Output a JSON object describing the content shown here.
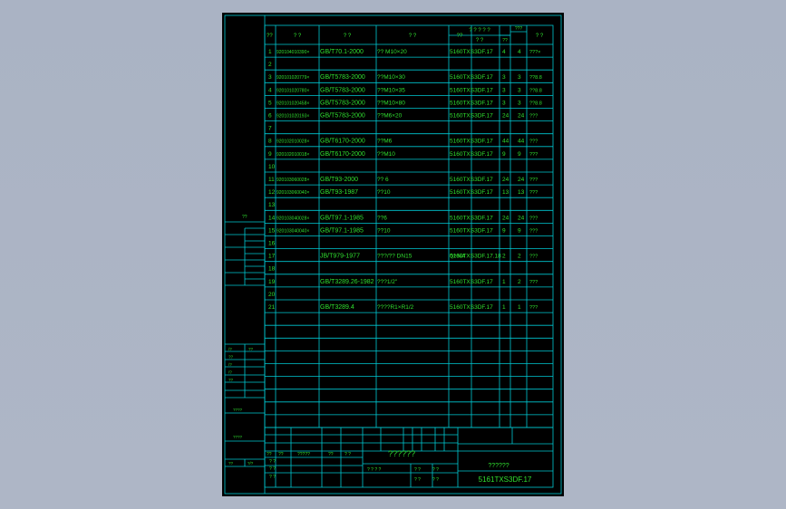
{
  "colors": {
    "background": "#aab3c4",
    "sheet": "#000000",
    "frame": "#00c8d2",
    "text": "#30e030"
  },
  "header": {
    "c1": "??",
    "c2": "?  ?",
    "c3": "?   ?",
    "c4": "?   ?",
    "c5": "??",
    "c6a": "? ? ? ? ?",
    "c6b": "?   ?",
    "c7a": "???",
    "c7b": "??",
    "c8": "?  ?"
  },
  "rows": [
    {
      "no": "1",
      "code": "920104010390×",
      "std": "GB/T70.1-2000",
      "name": "?? M10×20",
      "mat": "",
      "asm": "5160TXS3DF.17",
      "q1": "4",
      "q2": "4",
      "note": "???×"
    },
    {
      "no": "2",
      "code": "",
      "std": "",
      "name": "",
      "mat": "",
      "asm": "",
      "q1": "",
      "q2": "",
      "note": ""
    },
    {
      "no": "3",
      "code": "920101020779×",
      "std": "GB/T5783-2000",
      "name": "??M10×30",
      "mat": "",
      "asm": "5160TXS3DF.17",
      "q1": "3",
      "q2": "3",
      "note": "??8.8"
    },
    {
      "no": "4",
      "code": "920101020780×",
      "std": "GB/T5783-2000",
      "name": "??M10×35",
      "mat": "",
      "asm": "5160TXS3DF.17",
      "q1": "3",
      "q2": "3",
      "note": "??8.8"
    },
    {
      "no": "5",
      "code": "920101020458×",
      "std": "GB/T5783-2000",
      "name": "??M10×80",
      "mat": "",
      "asm": "5160TXS3DF.17",
      "q1": "3",
      "q2": "3",
      "note": "??8.8"
    },
    {
      "no": "6",
      "code": "920101020193×",
      "std": "GB/T5783-2000",
      "name": "??M6×20",
      "mat": "",
      "asm": "5160TXS3DF.17",
      "q1": "24",
      "q2": "24",
      "note": "???"
    },
    {
      "no": "7",
      "code": "",
      "std": "",
      "name": "",
      "mat": "",
      "asm": "",
      "q1": "",
      "q2": "",
      "note": ""
    },
    {
      "no": "8",
      "code": "920102010028×",
      "std": "GB/T6170-2000",
      "name": "??M6",
      "mat": "",
      "asm": "5160TXS3DF.17",
      "q1": "44",
      "q2": "44",
      "note": "???"
    },
    {
      "no": "9",
      "code": "920102010018×",
      "std": "GB/T6170-2000",
      "name": "??M10",
      "mat": "",
      "asm": "5160TXS3DF.17",
      "q1": "9",
      "q2": "9",
      "note": "???"
    },
    {
      "no": "10",
      "code": "",
      "std": "",
      "name": "",
      "mat": "",
      "asm": "",
      "q1": "",
      "q2": "",
      "note": ""
    },
    {
      "no": "11",
      "code": "920103060028×",
      "std": "GB/T93-2000",
      "name": "?? 6",
      "mat": "",
      "asm": "5160TXS3DF.17",
      "q1": "24",
      "q2": "24",
      "note": "???"
    },
    {
      "no": "12",
      "code": "920103060040×",
      "std": "GB/T93-1987",
      "name": "??10",
      "mat": "",
      "asm": "5160TXS3DF.17",
      "q1": "13",
      "q2": "13",
      "note": "???"
    },
    {
      "no": "13",
      "code": "",
      "std": "",
      "name": "",
      "mat": "",
      "asm": "",
      "q1": "",
      "q2": "",
      "note": ""
    },
    {
      "no": "14",
      "code": "920103040028×",
      "std": "GB/T97.1-1985",
      "name": "??6",
      "mat": "",
      "asm": "5160TXS3DF.17",
      "q1": "24",
      "q2": "24",
      "note": "???"
    },
    {
      "no": "15",
      "code": "920103040040×",
      "std": "GB/T97.1-1985",
      "name": "??10",
      "mat": "",
      "asm": "5160TXS3DF.17",
      "q1": "9",
      "q2": "9",
      "note": "???"
    },
    {
      "no": "16",
      "code": "",
      "std": "",
      "name": "",
      "mat": "",
      "asm": "",
      "q1": "",
      "q2": "",
      "note": ""
    },
    {
      "no": "17",
      "code": "",
      "std": "JB/T979-1977",
      "name": "???/?? DN15",
      "mat": "Q235A",
      "asm": "5160TXS3DF.17.18",
      "q1": "2",
      "q2": "2",
      "note": "???"
    },
    {
      "no": "18",
      "code": "",
      "std": "",
      "name": "",
      "mat": "",
      "asm": "",
      "q1": "",
      "q2": "",
      "note": ""
    },
    {
      "no": "19",
      "code": "",
      "std": "GB/T3289.26-1982",
      "name": "???1/2\"",
      "mat": "",
      "asm": "5160TXS3DF.17",
      "q1": "1",
      "q2": "2",
      "note": "???"
    },
    {
      "no": "20",
      "code": "",
      "std": "",
      "name": "",
      "mat": "",
      "asm": "",
      "q1": "",
      "q2": "",
      "note": ""
    },
    {
      "no": "21",
      "code": "",
      "std": "GB/T3289.4",
      "name": "????R1×R1/2",
      "mat": "",
      "asm": "5160TXS3DF.17",
      "q1": "1",
      "q2": "1",
      "note": "???"
    }
  ],
  "left_column": {
    "label_top": "??",
    "labels_mid": [
      "/?",
      "??",
      "/?",
      "/?",
      "??"
    ],
    "labels_mid2": [
      "??"
    ],
    "label_bottom1": "????",
    "label_bottom2": "????",
    "label_sign1": "??",
    "label_sign2": "?/?"
  },
  "title_block": {
    "r1": [
      "??",
      "??",
      "?????",
      "??",
      "? ?"
    ],
    "r2": [
      "? ?"
    ],
    "r3": [
      "? ?"
    ],
    "r4": [
      "? ?"
    ],
    "title": "??????",
    "sub1": "? ? ? ?",
    "sub2": "?  ?",
    "sub3": "? ?",
    "sub4": "? ?",
    "sub5": "? ?",
    "name_small": "??????",
    "code": "5161TXS3DF.17"
  }
}
